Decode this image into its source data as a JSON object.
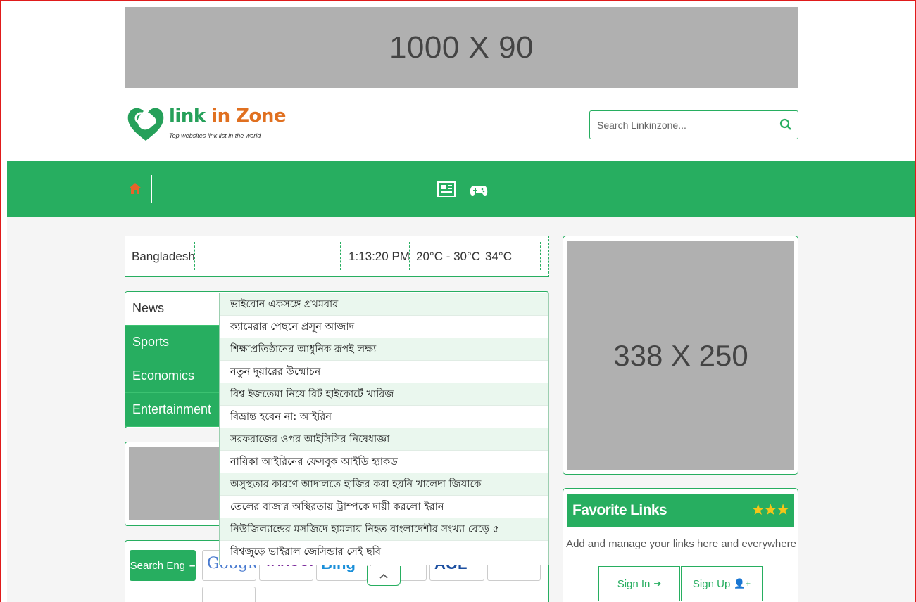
{
  "top_ad": {
    "label": "1000 X 90"
  },
  "logo": {
    "part1": "link ",
    "part2": "in Zone",
    "tagline": "Top websites link list in the world"
  },
  "search": {
    "placeholder": "Search Linkinzone..."
  },
  "navbar": {
    "icons": [
      "home-icon",
      "news-icon",
      "gamepad-icon"
    ]
  },
  "info_bar": {
    "country": "Bangladesh",
    "time": "1:13:20 PM",
    "temp_range": "20°C - 30°C",
    "temp_now": "34°C"
  },
  "categories": [
    {
      "label": "News"
    },
    {
      "label": "Sports"
    },
    {
      "label": "Economics"
    },
    {
      "label": "Entertainment"
    }
  ],
  "news_items": [
    "ভাইবোন একসঙ্গে প্রথমবার",
    "ক্যামেরার পেছনে প্রসূন আজাদ",
    "শিক্ষাপ্রতিষ্ঠানের আধুনিক রূপই লক্ষ্য",
    "নতুন দুয়ারের উন্মোচন",
    "বিশ্ব ইজতেমা নিয়ে রিট হাইকোর্টে খারিজ",
    "বিভ্রান্ত হবেন না: আইরিন",
    "সরফরাজের ওপর আইসিসির নিষেধাজ্ঞা",
    "নায়িকা আইরিনের ফেসবুক আইডি হ্যাকড",
    "অসুস্থতার কারণে আদালতে হাজির করা হয়নি খালেদা জিয়াকে",
    "তেলের বাজার অস্থিরতায় ট্রাম্পকে দায়ী করলো ইরান",
    "নিউজিল্যান্ডের মসজিদে হামলায় নিহত বাংলাদেশীর সংখ্যা বেড়ে ৫",
    "বিশ্বজুড়ে ভাইরাল জেসিন্ডার সেই ছবি"
  ],
  "search_engines": {
    "button_label": "Search Eng",
    "tiles": [
      "Google",
      "YAHOO!",
      "Bing",
      "",
      "AOL",
      ""
    ]
  },
  "right_ad": {
    "label": "338 X 250"
  },
  "favorite_links": {
    "title": "Favorite Links",
    "stars": "★★★",
    "description": "Add and manage your links here and everywhere",
    "sign_in": "Sign In",
    "sign_up": "Sign Up"
  },
  "colors": {
    "brand_green": "#27ae60",
    "accent_orange": "#e07020",
    "ad_grey": "#b0b0b0"
  }
}
